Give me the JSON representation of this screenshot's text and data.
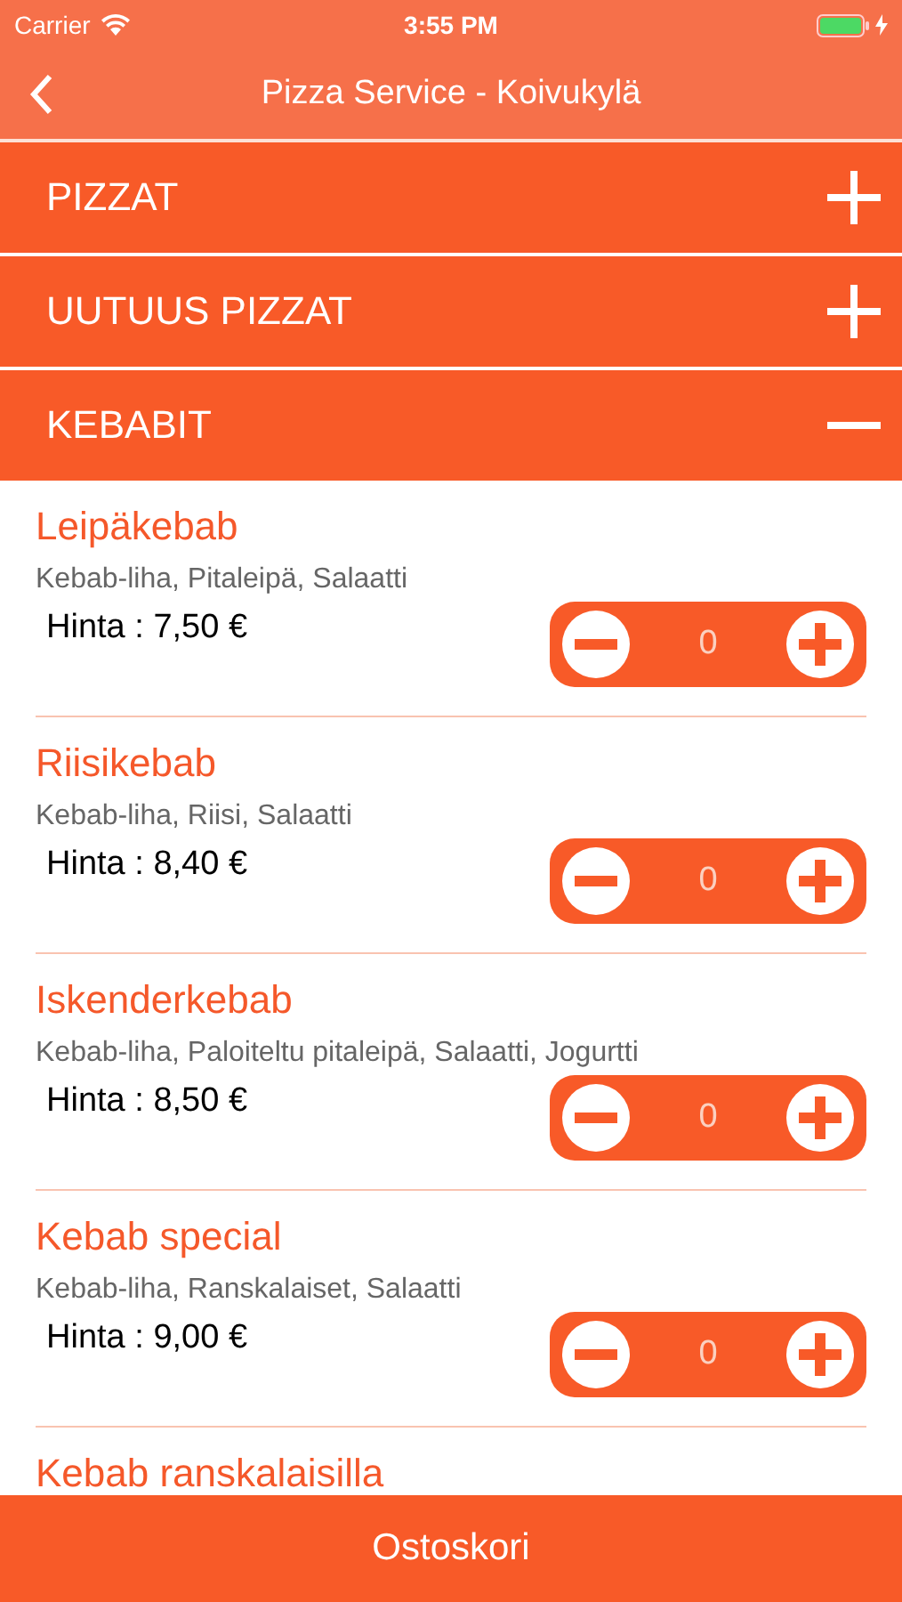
{
  "status_bar": {
    "carrier": "Carrier",
    "time": "3:55 PM",
    "charging": true
  },
  "nav": {
    "title": "Pizza Service - Koivukylä"
  },
  "categories": [
    {
      "label": "PIZZAT",
      "expanded": false
    },
    {
      "label": "UUTUUS PIZZAT",
      "expanded": false
    },
    {
      "label": "KEBABIT",
      "expanded": true
    }
  ],
  "items": [
    {
      "name": "Leipäkebab",
      "description": "Kebab-liha, Pitaleipä, Salaatti",
      "price": "Hinta : 7,50 €",
      "quantity": "0"
    },
    {
      "name": "Riisikebab",
      "description": "Kebab-liha, Riisi, Salaatti",
      "price": "Hinta : 8,40 €",
      "quantity": "0"
    },
    {
      "name": "Iskenderkebab",
      "description": "Kebab-liha, Paloiteltu pitaleipä, Salaatti, Jogurtti",
      "price": "Hinta : 8,50 €",
      "quantity": "0"
    },
    {
      "name": "Kebab special",
      "description": "Kebab-liha, Ranskalaiset, Salaatti",
      "price": "Hinta : 9,00 €",
      "quantity": "0"
    },
    {
      "name": "Kebab ranskalaisilla"
    }
  ],
  "bottom_bar": {
    "label": "Ostoskori"
  }
}
